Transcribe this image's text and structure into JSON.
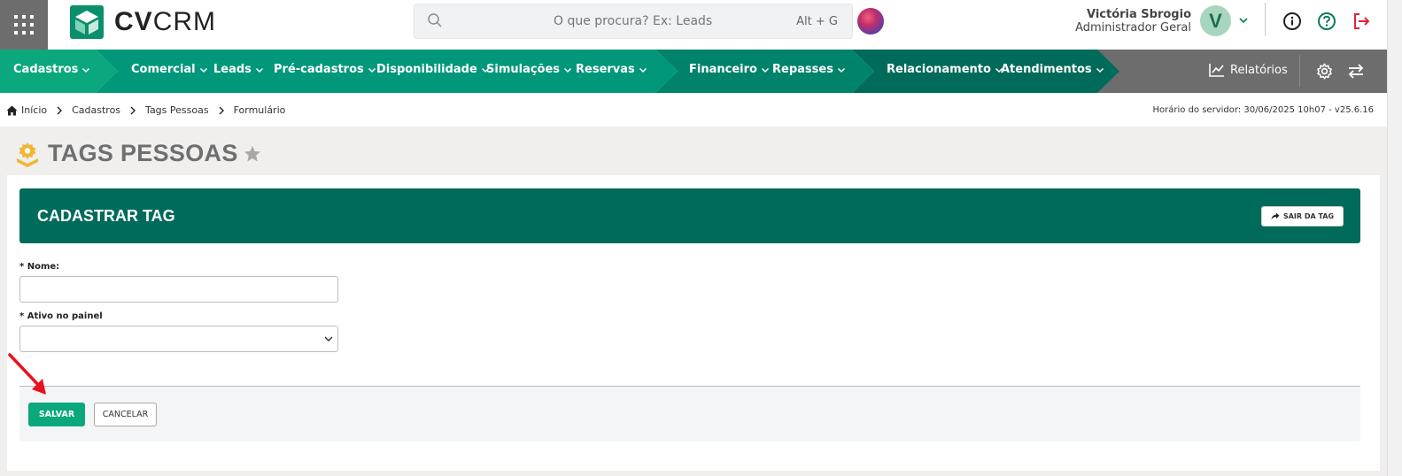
{
  "header": {
    "logo_bold": "CV",
    "logo_light": "CRM",
    "search_placeholder": "O que procura? Ex: Leads",
    "search_shortcut": "Alt + G",
    "user_name": "Victória Sbrogio",
    "user_role": "Administrador Geral",
    "avatar_initial": "V"
  },
  "nav": {
    "items": [
      {
        "label": "Cadastros"
      },
      {
        "label": "Comercial"
      },
      {
        "label": "Leads"
      },
      {
        "label": "Pré-cadastros"
      },
      {
        "label": "Disponibilidade"
      },
      {
        "label": "Simulações"
      },
      {
        "label": "Reservas"
      },
      {
        "label": "Financeiro"
      },
      {
        "label": "Repasses"
      },
      {
        "label": "Relacionamento"
      },
      {
        "label": "Atendimentos"
      }
    ],
    "reports_label": "Relatórios",
    "colors": {
      "seg1": "#0aa87c",
      "seg2": "#00977b",
      "seg3": "#00836b",
      "seg4": "#006b5a",
      "tools": "#6d6d6d"
    }
  },
  "breadcrumb": {
    "items": [
      "Início",
      "Cadastros",
      "Tags Pessoas",
      "Formulário"
    ],
    "server_info": "Horário do servidor: 30/06/2025 10h07 - v25.6.16"
  },
  "page": {
    "title": "TAGS PESSOAS"
  },
  "form": {
    "header_title": "CADASTRAR TAG",
    "exit_label": "SAIR DA TAG",
    "name_label": "* Nome:",
    "name_value": "",
    "active_label": "* Ativo no painel",
    "active_value": "",
    "save_label": "SALVAR",
    "cancel_label": "CANCELAR"
  }
}
